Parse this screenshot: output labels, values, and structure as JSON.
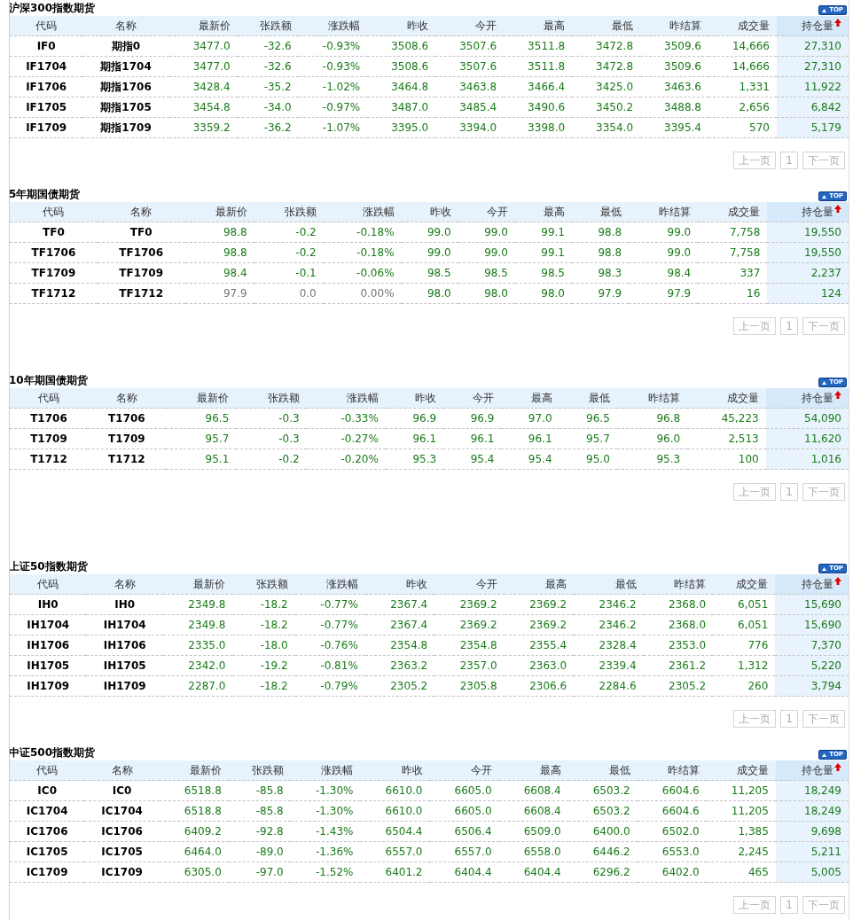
{
  "sections": [
    {
      "title": "沪深300指数期货",
      "top": "TOP",
      "columns": [
        "代码",
        "名称",
        "最新价",
        "张跌额",
        "涨跌幅",
        "昨收",
        "今开",
        "最高",
        "最低",
        "昨结算",
        "成交量",
        "持仓量"
      ],
      "rows": [
        {
          "color": "#1a7a1a",
          "cells": [
            "IF0",
            "期指0",
            "3477.0",
            "-32.6",
            "-0.93%",
            "3508.6",
            "3507.6",
            "3511.8",
            "3472.8",
            "3509.6",
            "14,666",
            "27,310"
          ]
        },
        {
          "color": "#1a7a1a",
          "cells": [
            "IF1704",
            "期指1704",
            "3477.0",
            "-32.6",
            "-0.93%",
            "3508.6",
            "3507.6",
            "3511.8",
            "3472.8",
            "3509.6",
            "14,666",
            "27,310"
          ]
        },
        {
          "color": "#1a7a1a",
          "cells": [
            "IF1706",
            "期指1706",
            "3428.4",
            "-35.2",
            "-1.02%",
            "3464.8",
            "3463.8",
            "3466.4",
            "3425.0",
            "3463.6",
            "1,331",
            "11,922"
          ]
        },
        {
          "color": "#1a7a1a",
          "cells": [
            "IF1705",
            "期指1705",
            "3454.8",
            "-34.0",
            "-0.97%",
            "3487.0",
            "3485.4",
            "3490.6",
            "3450.2",
            "3488.8",
            "2,656",
            "6,842"
          ]
        },
        {
          "color": "#1a7a1a",
          "cells": [
            "IF1709",
            "期指1709",
            "3359.2",
            "-36.2",
            "-1.07%",
            "3395.0",
            "3394.0",
            "3398.0",
            "3354.0",
            "3395.4",
            "570",
            "5,179"
          ]
        }
      ],
      "pager": {
        "prev": "上一页",
        "page": "1",
        "next": "下一页"
      }
    },
    {
      "title": "5年期国债期货",
      "top": "TOP",
      "columns": [
        "代码",
        "名称",
        "最新价",
        "张跌额",
        "涨跌幅",
        "昨收",
        "今开",
        "最高",
        "最低",
        "昨结算",
        "成交量",
        "持仓量"
      ],
      "rows": [
        {
          "color": "#1a7a1a",
          "cells": [
            "TF0",
            "TF0",
            "98.8",
            "-0.2",
            "-0.18%",
            "99.0",
            "99.0",
            "99.1",
            "98.8",
            "99.0",
            "7,758",
            "19,550"
          ]
        },
        {
          "color": "#1a7a1a",
          "cells": [
            "TF1706",
            "TF1706",
            "98.8",
            "-0.2",
            "-0.18%",
            "99.0",
            "99.0",
            "99.1",
            "98.8",
            "99.0",
            "7,758",
            "19,550"
          ]
        },
        {
          "color": "#1a7a1a",
          "cells": [
            "TF1709",
            "TF1709",
            "98.4",
            "-0.1",
            "-0.06%",
            "98.5",
            "98.5",
            "98.5",
            "98.3",
            "98.4",
            "337",
            "2,237"
          ]
        },
        {
          "color": "#777777",
          "cells": [
            "TF1712",
            "TF1712",
            "97.9",
            "0.0",
            "0.00%",
            "98.0",
            "98.0",
            "98.0",
            "97.9",
            "97.9",
            "16",
            "124"
          ]
        }
      ],
      "pager": {
        "prev": "上一页",
        "page": "1",
        "next": "下一页"
      }
    },
    {
      "title": "10年期国债期货",
      "top": "TOP",
      "columns": [
        "代码",
        "名称",
        "最新价",
        "张跌额",
        "涨跌幅",
        "昨收",
        "今开",
        "最高",
        "最低",
        "昨结算",
        "成交量",
        "持仓量"
      ],
      "rows": [
        {
          "color": "#1a7a1a",
          "cells": [
            "T1706",
            "T1706",
            "96.5",
            "-0.3",
            "-0.33%",
            "96.9",
            "96.9",
            "97.0",
            "96.5",
            "96.8",
            "45,223",
            "54,090"
          ]
        },
        {
          "color": "#1a7a1a",
          "cells": [
            "T1709",
            "T1709",
            "95.7",
            "-0.3",
            "-0.27%",
            "96.1",
            "96.1",
            "96.1",
            "95.7",
            "96.0",
            "2,513",
            "11,620"
          ]
        },
        {
          "color": "#1a7a1a",
          "cells": [
            "T1712",
            "T1712",
            "95.1",
            "-0.2",
            "-0.20%",
            "95.3",
            "95.4",
            "95.4",
            "95.0",
            "95.3",
            "100",
            "1,016"
          ]
        }
      ],
      "pager": {
        "prev": "上一页",
        "page": "1",
        "next": "下一页"
      }
    },
    {
      "title": "上证50指数期货",
      "top": "TOP",
      "columns": [
        "代码",
        "名称",
        "最新价",
        "张跌额",
        "涨跌幅",
        "昨收",
        "今开",
        "最高",
        "最低",
        "昨结算",
        "成交量",
        "持仓量"
      ],
      "rows": [
        {
          "color": "#1a7a1a",
          "cells": [
            "IH0",
            "IH0",
            "2349.8",
            "-18.2",
            "-0.77%",
            "2367.4",
            "2369.2",
            "2369.2",
            "2346.2",
            "2368.0",
            "6,051",
            "15,690"
          ]
        },
        {
          "color": "#1a7a1a",
          "cells": [
            "IH1704",
            "IH1704",
            "2349.8",
            "-18.2",
            "-0.77%",
            "2367.4",
            "2369.2",
            "2369.2",
            "2346.2",
            "2368.0",
            "6,051",
            "15,690"
          ]
        },
        {
          "color": "#1a7a1a",
          "cells": [
            "IH1706",
            "IH1706",
            "2335.0",
            "-18.0",
            "-0.76%",
            "2354.8",
            "2354.8",
            "2355.4",
            "2328.4",
            "2353.0",
            "776",
            "7,370"
          ]
        },
        {
          "color": "#1a7a1a",
          "cells": [
            "IH1705",
            "IH1705",
            "2342.0",
            "-19.2",
            "-0.81%",
            "2363.2",
            "2357.0",
            "2363.0",
            "2339.4",
            "2361.2",
            "1,312",
            "5,220"
          ]
        },
        {
          "color": "#1a7a1a",
          "cells": [
            "IH1709",
            "IH1709",
            "2287.0",
            "-18.2",
            "-0.79%",
            "2305.2",
            "2305.8",
            "2306.6",
            "2284.6",
            "2305.2",
            "260",
            "3,794"
          ]
        }
      ],
      "pager": {
        "prev": "上一页",
        "page": "1",
        "next": "下一页"
      }
    },
    {
      "title": "中证500指数期货",
      "top": "TOP",
      "columns": [
        "代码",
        "名称",
        "最新价",
        "张跌额",
        "涨跌幅",
        "昨收",
        "今开",
        "最高",
        "最低",
        "昨结算",
        "成交量",
        "持仓量"
      ],
      "rows": [
        {
          "color": "#1a7a1a",
          "cells": [
            "IC0",
            "IC0",
            "6518.8",
            "-85.8",
            "-1.30%",
            "6610.0",
            "6605.0",
            "6608.4",
            "6503.2",
            "6604.6",
            "11,205",
            "18,249"
          ]
        },
        {
          "color": "#1a7a1a",
          "cells": [
            "IC1704",
            "IC1704",
            "6518.8",
            "-85.8",
            "-1.30%",
            "6610.0",
            "6605.0",
            "6608.4",
            "6503.2",
            "6604.6",
            "11,205",
            "18,249"
          ]
        },
        {
          "color": "#1a7a1a",
          "cells": [
            "IC1706",
            "IC1706",
            "6409.2",
            "-92.8",
            "-1.43%",
            "6504.4",
            "6506.4",
            "6509.0",
            "6400.0",
            "6502.0",
            "1,385",
            "9,698"
          ]
        },
        {
          "color": "#1a7a1a",
          "cells": [
            "IC1705",
            "IC1705",
            "6464.0",
            "-89.0",
            "-1.36%",
            "6557.0",
            "6557.0",
            "6558.0",
            "6446.2",
            "6553.0",
            "2,245",
            "5,211"
          ]
        },
        {
          "color": "#1a7a1a",
          "cells": [
            "IC1709",
            "IC1709",
            "6305.0",
            "-97.0",
            "-1.52%",
            "6401.2",
            "6404.4",
            "6404.4",
            "6296.2",
            "6402.0",
            "465",
            "5,005"
          ]
        }
      ],
      "pager": {
        "prev": "上一页",
        "page": "1",
        "next": "下一页"
      }
    }
  ]
}
